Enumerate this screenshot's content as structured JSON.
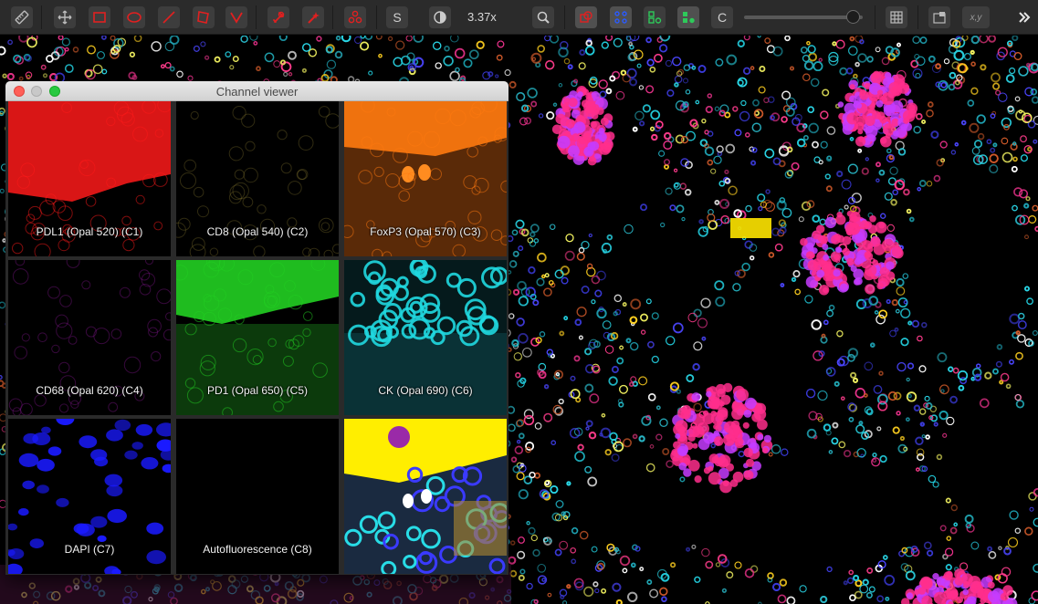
{
  "toolbar": {
    "tools": [
      {
        "name": "measure-tool-button",
        "icon": "ruler-icon"
      },
      {
        "name": "move-tool-button",
        "icon": "move-icon"
      },
      {
        "name": "rectangle-tool-button",
        "icon": "rectangle-icon"
      },
      {
        "name": "ellipse-tool-button",
        "icon": "ellipse-icon"
      },
      {
        "name": "line-tool-button",
        "icon": "line-icon"
      },
      {
        "name": "polygon-tool-button",
        "icon": "polygon-icon"
      },
      {
        "name": "polyline-tool-button",
        "icon": "polyline-icon"
      },
      {
        "name": "brush-tool-button",
        "icon": "brush-icon"
      },
      {
        "name": "wand-tool-button",
        "icon": "wand-icon"
      },
      {
        "name": "points-tool-button",
        "icon": "points-icon"
      }
    ],
    "s_label": "S",
    "zoom_value": "3.37x",
    "c_label": "C",
    "coords_label": "x,y",
    "slider_fraction": 0.92
  },
  "channel_viewer": {
    "title": "Channel viewer",
    "channels": [
      {
        "label": "PDL1 (Opal 520) (C1)",
        "color": "#ff1a1a"
      },
      {
        "label": "CD8 (Opal 540) (C2)",
        "color": "#8a7a30"
      },
      {
        "label": "FoxP3 (Opal 570) (C3)",
        "color": "#ff7a10"
      },
      {
        "label": "CD68 (Opal 620) (C4)",
        "color": "#9a1aa8"
      },
      {
        "label": "PD1 (Opal 650) (C5)",
        "color": "#22d022"
      },
      {
        "label": "CK (Opal 690) (C6)",
        "color": "#20d8e0"
      },
      {
        "label": "DAPI (C7)",
        "color": "#1a1aff"
      },
      {
        "label": "Autofluorescence (C8)",
        "color": "#000000"
      },
      {
        "label": "",
        "color": "composite"
      }
    ]
  }
}
